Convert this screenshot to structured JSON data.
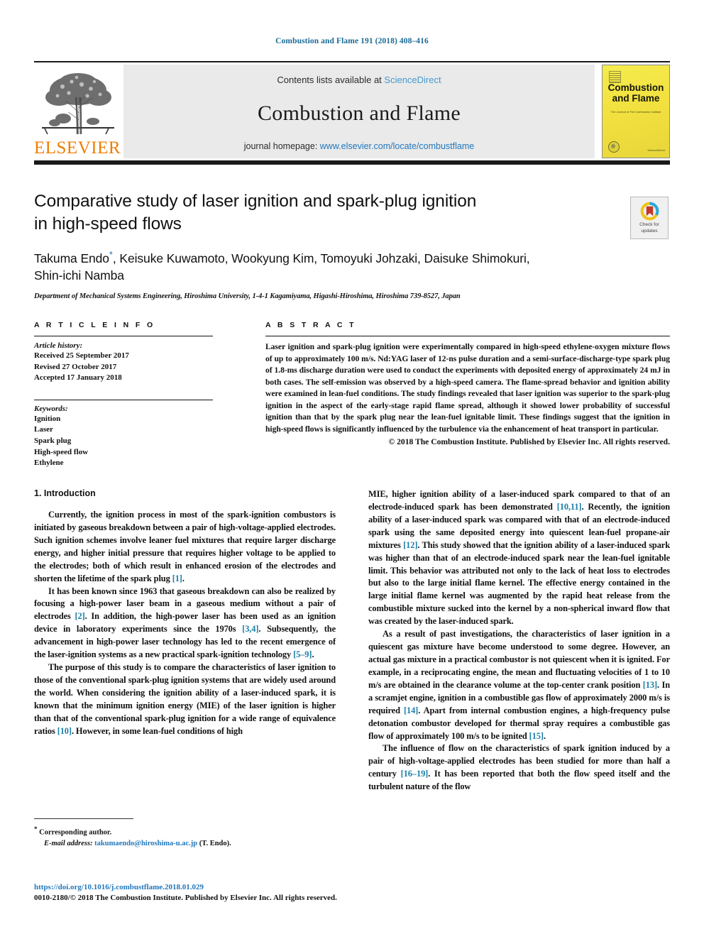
{
  "running_head": "Combustion and Flame 191 (2018) 408–416",
  "masthead": {
    "contents_prefix": "Contents lists available at ",
    "sciencedirect_link": "ScienceDirect",
    "journal_title": "Combustion and Flame",
    "homepage_prefix": "journal homepage: ",
    "homepage_link": "www.elsevier.com/locate/combustflame",
    "publisher_wordmark": "ELSEVIER",
    "cover": {
      "title_line1": "Combustion",
      "title_line2": "and Flame",
      "subtitle": "The Journal of The Combustion Institute",
      "brand": "ScienceDirect"
    }
  },
  "crossmark": {
    "label_line1": "Check for",
    "label_line2": "updates"
  },
  "article": {
    "title_line1": "Comparative study of laser ignition and spark-plug ignition",
    "title_line2": "in high-speed flows",
    "authors_line1": "Takuma Endo",
    "authors_star": "*",
    "authors_line1_rest": ", Keisuke Kuwamoto, Wookyung Kim, Tomoyuki Johzaki, Daisuke Shimokuri,",
    "authors_line2": "Shin-ichi Namba",
    "affiliation": "Department of Mechanical Systems Engineering, Hiroshima University, 1-4-1 Kagamiyama, Higashi-Hiroshima, Hiroshima 739-8527, Japan"
  },
  "article_info": {
    "heading": "A R T I C L E   I N F O",
    "history_label": "Article history:",
    "history": [
      "Received 25 September 2017",
      "Revised 27 October 2017",
      "Accepted 17 January 2018"
    ],
    "keywords_label": "Keywords:",
    "keywords": [
      "Ignition",
      "Laser",
      "Spark plug",
      "High-speed flow",
      "Ethylene"
    ]
  },
  "abstract": {
    "heading": "A B S T R A C T",
    "text": "Laser ignition and spark-plug ignition were experimentally compared in high-speed ethylene-oxygen mixture flows of up to approximately 100 m/s. Nd:YAG laser of 12-ns pulse duration and a semi-surface-discharge-type spark plug of 1.8-ms discharge duration were used to conduct the experiments with deposited energy of approximately 24 mJ in both cases. The self-emission was observed by a high-speed camera. The flame-spread behavior and ignition ability were examined in lean-fuel conditions. The study findings revealed that laser ignition was superior to the spark-plug ignition in the aspect of the early-stage rapid flame spread, although it showed lower probability of successful ignition than that by the spark plug near the lean-fuel ignitable limit. These findings suggest that the ignition in high-speed flows is significantly influenced by the turbulence via the enhancement of heat transport in particular.",
    "copyright": "© 2018 The Combustion Institute. Published by Elsevier Inc. All rights reserved."
  },
  "body": {
    "section_heading": "1. Introduction",
    "left_paragraphs": [
      "Currently, the ignition process in most of the spark-ignition combustors is initiated by gaseous breakdown between a pair of high-voltage-applied electrodes. Such ignition schemes involve leaner fuel mixtures that require larger discharge energy, and higher initial pressure that requires higher voltage to be applied to the electrodes; both of which result in enhanced erosion of the electrodes and shorten the lifetime of the spark plug [1].",
      "It has been known since 1963 that gaseous breakdown can also be realized by focusing a high-power laser beam in a gaseous medium without a pair of electrodes [2]. In addition, the high-power laser has been used as an ignition device in laboratory experiments since the 1970s [3,4]. Subsequently, the advancement in high-power laser technology has led to the recent emergence of the laser-ignition systems as a new practical spark-ignition technology [5–9].",
      "The purpose of this study is to compare the characteristics of laser ignition to those of the conventional spark-plug ignition systems that are widely used around the world. When considering the ignition ability of a laser-induced spark, it is known that the minimum ignition energy (MIE) of the laser ignition is higher than that of the conventional spark-plug ignition for a wide range of equivalence ratios [10]. However, in some lean-fuel conditions of high"
    ],
    "right_paragraphs": [
      "MIE, higher ignition ability of a laser-induced spark compared to that of an electrode-induced spark has been demonstrated [10,11]. Recently, the ignition ability of a laser-induced spark was compared with that of an electrode-induced spark using the same deposited energy into quiescent lean-fuel propane-air mixtures [12]. This study showed that the ignition ability of a laser-induced spark was higher than that of an electrode-induced spark near the lean-fuel ignitable limit. This behavior was attributed not only to the lack of heat loss to electrodes but also to the large initial flame kernel. The effective energy contained in the large initial flame kernel was augmented by the rapid heat release from the combustible mixture sucked into the kernel by a non-spherical inward flow that was created by the laser-induced spark.",
      "As a result of past investigations, the characteristics of laser ignition in a quiescent gas mixture have become understood to some degree. However, an actual gas mixture in a practical combustor is not quiescent when it is ignited. For example, in a reciprocating engine, the mean and fluctuating velocities of 1 to 10 m/s are obtained in the clearance volume at the top-center crank position [13]. In a scramjet engine, ignition in a combustible gas flow of approximately 2000 m/s is required [14]. Apart from internal combustion engines, a high-frequency pulse detonation combustor developed for thermal spray requires a combustible gas flow of approximately 100 m/s to be ignited [15].",
      "The influence of flow on the characteristics of spark ignition induced by a pair of high-voltage-applied electrodes has been studied for more than half a century [16–19]. It has been reported that both the flow speed itself and the turbulent nature of the flow"
    ]
  },
  "footnote": {
    "star": "*",
    "corresponding": "Corresponding author.",
    "email_label": "E-mail address:",
    "email": "takumaendo@hiroshima-u.ac.jp",
    "email_suffix": "(T. Endo)."
  },
  "footer": {
    "doi": "https://doi.org/10.1016/j.combustflame.2018.01.029",
    "copyright": "0010-2180/© 2018 The Combustion Institute. Published by Elsevier Inc. All rights reserved."
  },
  "colors": {
    "link_blue": "#2277bb",
    "running_head_blue": "#1b6a94",
    "reference_blue": "#1b7fa8",
    "elsevier_orange": "#ef7d00",
    "cover_yellow": "#f2e34c",
    "banner_gray": "#eaeaea"
  }
}
